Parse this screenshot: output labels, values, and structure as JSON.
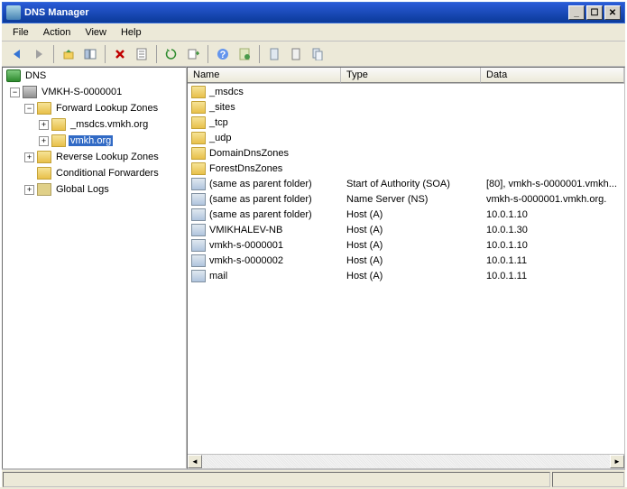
{
  "window": {
    "title": "DNS Manager"
  },
  "menu": {
    "file": "File",
    "action": "Action",
    "view": "View",
    "help": "Help"
  },
  "tree": {
    "root": "DNS",
    "server": "VMKH-S-0000001",
    "flz": "Forward Lookup Zones",
    "zone1": "_msdcs.vmkh.org",
    "zone2": "vmkh.org",
    "rlz": "Reverse Lookup Zones",
    "cf": "Conditional Forwarders",
    "logs": "Global Logs"
  },
  "columns": {
    "name": "Name",
    "type": "Type",
    "data": "Data"
  },
  "records": [
    {
      "name": "_msdcs",
      "type": "",
      "data": "",
      "icon": "folder"
    },
    {
      "name": "_sites",
      "type": "",
      "data": "",
      "icon": "folder"
    },
    {
      "name": "_tcp",
      "type": "",
      "data": "",
      "icon": "folder"
    },
    {
      "name": "_udp",
      "type": "",
      "data": "",
      "icon": "folder"
    },
    {
      "name": "DomainDnsZones",
      "type": "",
      "data": "",
      "icon": "folder"
    },
    {
      "name": "ForestDnsZones",
      "type": "",
      "data": "",
      "icon": "folder"
    },
    {
      "name": "(same as parent folder)",
      "type": "Start of Authority (SOA)",
      "data": "[80], vmkh-s-0000001.vmkh...",
      "icon": "record"
    },
    {
      "name": "(same as parent folder)",
      "type": "Name Server (NS)",
      "data": "vmkh-s-0000001.vmkh.org.",
      "icon": "record"
    },
    {
      "name": "(same as parent folder)",
      "type": "Host (A)",
      "data": "10.0.1.10",
      "icon": "record"
    },
    {
      "name": "VMIKHALEV-NB",
      "type": "Host (A)",
      "data": "10.0.1.30",
      "icon": "record"
    },
    {
      "name": "vmkh-s-0000001",
      "type": "Host (A)",
      "data": "10.0.1.10",
      "icon": "record"
    },
    {
      "name": "vmkh-s-0000002",
      "type": "Host (A)",
      "data": "10.0.1.11",
      "icon": "record"
    },
    {
      "name": "mail",
      "type": "Host (A)",
      "data": "10.0.1.11",
      "icon": "record"
    }
  ]
}
